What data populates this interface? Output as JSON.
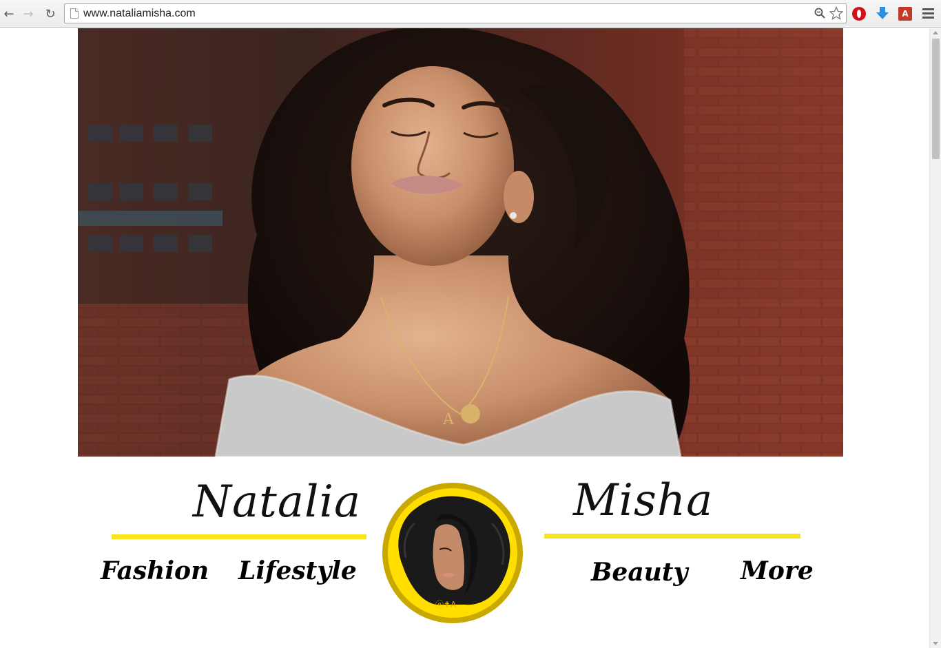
{
  "browser": {
    "url": "www.nataliamisha.com",
    "back_icon": "←",
    "forward_icon": "→",
    "reload_icon": "↻",
    "zoom_icon": "🔍",
    "star_icon": "☆",
    "pdf_label": "A"
  },
  "header": {
    "first_name": "Natalia",
    "last_name": "Misha"
  },
  "nav": {
    "fashion": "Fashion",
    "lifestyle": "Lifestyle",
    "beauty": "Beauty",
    "more": "More"
  },
  "colors": {
    "accent_yellow": "#f6e51c",
    "logo_ring_outer": "#c9a800",
    "logo_ring_inner": "#ffde00",
    "brick": "#7a3427"
  }
}
